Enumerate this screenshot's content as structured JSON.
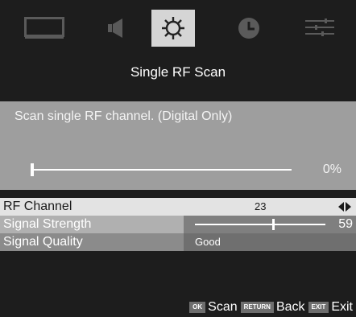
{
  "icons": [
    "picture-icon",
    "audio-icon",
    "settings-icon",
    "timer-icon",
    "more-icon"
  ],
  "screen_title": "Single RF Scan",
  "panel": {
    "description": "Scan single RF channel. (Digital Only)",
    "progress_percent": 0,
    "progress_text": "0%"
  },
  "rows": [
    {
      "label": "RF Channel",
      "value": "23"
    },
    {
      "label": "Signal Strength",
      "value": "59",
      "level": 59
    },
    {
      "label": "Signal Quality",
      "value": "Good"
    }
  ],
  "footer": {
    "ok_key": "OK",
    "ok_label": "Scan",
    "return_key": "RETURN",
    "return_label": "Back",
    "exit_key": "EXIT",
    "exit_label": "Exit"
  },
  "colors": {
    "background": "#1d1d1d",
    "active_icon_bg": "#d5d5d5",
    "panel": "#9e9e9e"
  }
}
